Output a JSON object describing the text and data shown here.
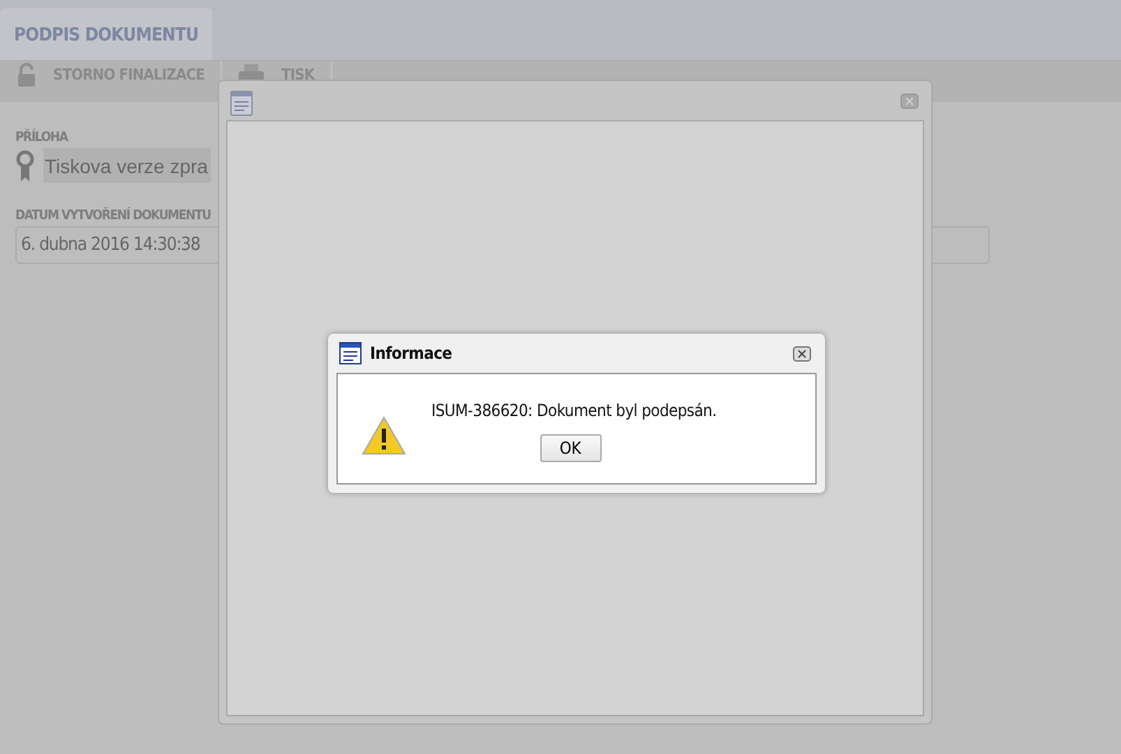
{
  "tabs": [
    {
      "label": "PODPIS DOKUMENTU",
      "selected": true
    }
  ],
  "toolbar": [
    {
      "label": "STORNO FINALIZACE",
      "kind": "lock"
    },
    {
      "label": "TISK",
      "kind": "printer"
    }
  ],
  "fields": [
    {
      "label": "PŘÍLOHA",
      "value": "Tiskova verze zpra",
      "kind": "attachment"
    },
    {
      "label": "DATUM VYTVOŘENÍ DOKUMENTU",
      "value": "6. dubna 2016 14:30:38",
      "kind": "text"
    }
  ],
  "dialog": {
    "title": "Informace",
    "message": "ISUM-386620: Dokument byl podepsán.",
    "button": "OK"
  }
}
